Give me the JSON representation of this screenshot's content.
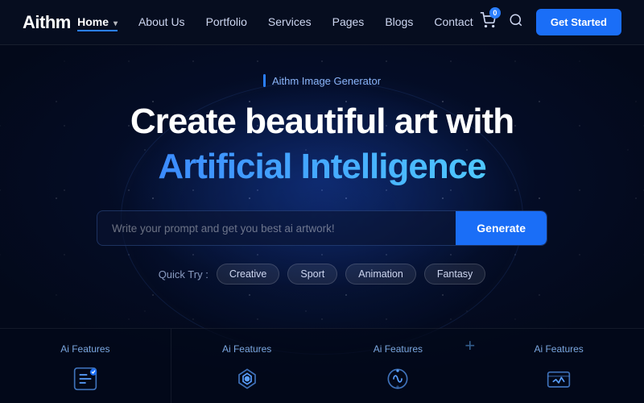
{
  "brand": {
    "logo": "Aithm"
  },
  "navbar": {
    "links": [
      {
        "id": "home",
        "label": "Home",
        "has_dropdown": true,
        "active": true
      },
      {
        "id": "about",
        "label": "About Us",
        "has_dropdown": false,
        "active": false
      },
      {
        "id": "portfolio",
        "label": "Portfolio",
        "has_dropdown": false,
        "active": false
      },
      {
        "id": "services",
        "label": "Services",
        "has_dropdown": false,
        "active": false
      },
      {
        "id": "pages",
        "label": "Pages",
        "has_dropdown": false,
        "active": false
      },
      {
        "id": "blogs",
        "label": "Blogs",
        "has_dropdown": false,
        "active": false
      },
      {
        "id": "contact",
        "label": "Contact",
        "has_dropdown": false,
        "active": false
      }
    ],
    "cart_count": "0",
    "cta_label": "Get Started"
  },
  "hero": {
    "badge_text": "Aithm Image Generator",
    "title_line1": "Create beautiful art with",
    "title_line2": "Artificial Intelligence",
    "search_placeholder": "Write your prompt and get you best ai artwork!",
    "generate_label": "Generate",
    "quick_try_label": "Quick Try :",
    "quick_try_tags": [
      "Creative",
      "Sport",
      "Animation",
      "Fantasy"
    ]
  },
  "features": [
    {
      "id": "f1",
      "label": "Ai Features"
    },
    {
      "id": "f2",
      "label": "Ai Features"
    },
    {
      "id": "f3",
      "label": "Ai Features"
    },
    {
      "id": "f4",
      "label": "Ai Features"
    }
  ]
}
